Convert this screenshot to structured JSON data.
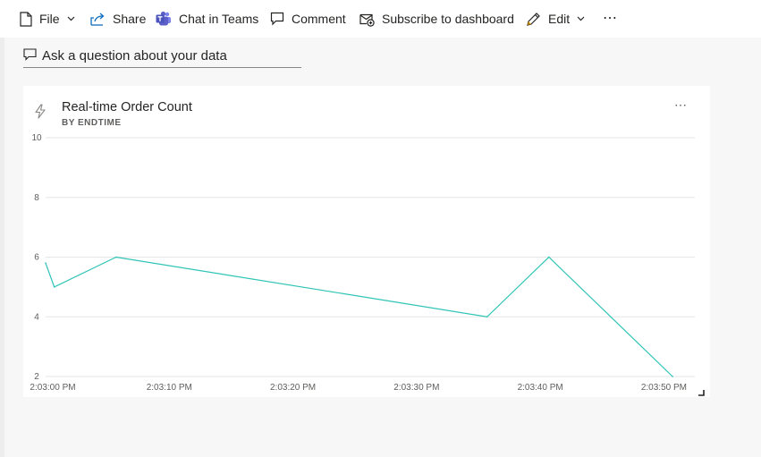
{
  "toolbar": {
    "file_label": "File",
    "share_label": "Share",
    "chat_label": "Chat in Teams",
    "comment_label": "Comment",
    "subscribe_label": "Subscribe to dashboard",
    "edit_label": "Edit",
    "more_label": "⋯"
  },
  "qa": {
    "label": "Ask a question about your data"
  },
  "tile": {
    "title": "Real-time Order Count",
    "subtitle": "BY ENDTIME",
    "more_label": "⋯"
  },
  "colors": {
    "line": "#2ec4b6",
    "gridline": "#e6e6e6",
    "teams": "#5b5fc7",
    "accent": "#0f6cbd"
  },
  "chart_data": {
    "type": "line",
    "title": "Real-time Order Count",
    "subtitle": "BY ENDTIME",
    "x": [
      "2:03:00 PM",
      "2:03:01 PM",
      "2:03:06 PM",
      "2:03:36 PM",
      "2:03:41 PM",
      "2:03:51 PM"
    ],
    "x_seconds": [
      0,
      0.7,
      5.7,
      35.7,
      40.7,
      50.7
    ],
    "series": [
      {
        "values": [
          5.8,
          5.0,
          6.0,
          4.0,
          6.0,
          2.0
        ]
      }
    ],
    "xticks": [
      "2:03:00 PM",
      "2:03:10 PM",
      "2:03:20 PM",
      "2:03:30 PM",
      "2:03:40 PM",
      "2:03:50 PM"
    ],
    "xticks_seconds": [
      0,
      10,
      20,
      30,
      40,
      50
    ],
    "yticks": [
      2,
      4,
      6,
      8,
      10
    ],
    "ylim": [
      2,
      10
    ],
    "xlim": [
      0,
      52.5
    ],
    "grid": true,
    "legend": "none"
  }
}
